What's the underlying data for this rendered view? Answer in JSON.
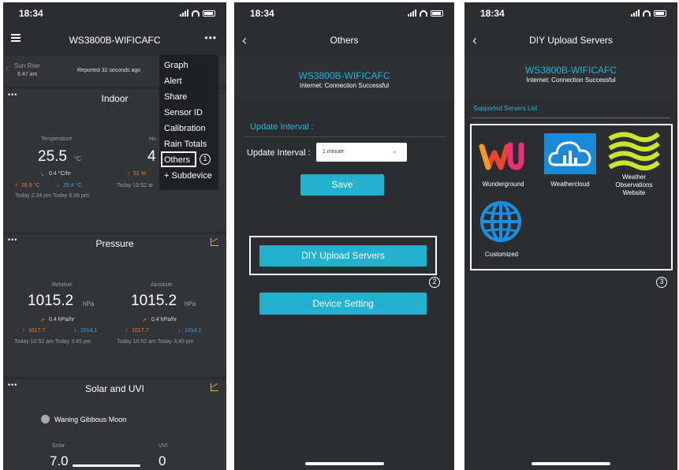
{
  "status_time": "18:34",
  "screen1": {
    "title": "WS3800B-WIFICAFC",
    "sunrise_label": "Sun Rise",
    "sunrise_time": "6:47 am",
    "reported": "Reported 32 seconds ago",
    "indoor": {
      "title": "Indoor",
      "temp_label": "Temperature",
      "temp_value": "25.5",
      "temp_unit": "°C",
      "hum_label": "Hu",
      "hum_value": "4",
      "temp_rate": "0.4 °C/hr",
      "hum_rate": "51 %",
      "temp_max": "26.9 °C",
      "temp_min": "25.4 °C",
      "hum_time": "Today 10:52 ar",
      "temp_times": "Today 2:34 pm   Today 6:28 pm"
    },
    "pressure": {
      "title": "Pressure",
      "rel_label": "Relative",
      "abs_label": "Absolute",
      "rel_value": "1015.2",
      "abs_value": "1015.2",
      "unit": "hPa",
      "rel_rate": "0.4 hPa/hr",
      "abs_rate": "0.4 hPa/hr",
      "rel_max": "1017.7",
      "rel_min": "1014.1",
      "abs_max": "1017.7",
      "abs_min": "1014.1",
      "rel_times": "Today 10:52 am   Today 3:45 pm",
      "abs_times": "Today 10:52 am   Today 3:45 pm"
    },
    "solar": {
      "title": "Solar and UVI",
      "moon": "Waning Gibbous Moon",
      "solar_label": "Solar",
      "uvi_label": "UVI",
      "solar_value": "7.0",
      "uvi_value": "0"
    },
    "menu": [
      "Graph",
      "Alert",
      "Share",
      "Sensor ID",
      "Calibration",
      "Rain Totals",
      "Others",
      "+ Subdevice"
    ],
    "callout": "1"
  },
  "screen2": {
    "title": "Others",
    "device": "WS3800B-WIFICAFC",
    "internet": "Internet: Connection Successful",
    "interval_header": "Update Interval :",
    "interval_label": "Update Interval :",
    "interval_value": "1 minute",
    "save": "Save",
    "diy": "DIY Upload Servers",
    "device_setting": "Device Setting",
    "callout": "2"
  },
  "screen3": {
    "title": "DIY Upload Servers",
    "device": "WS3800B-WIFICAFC",
    "internet": "Internet: Connection Successful",
    "list_label": "Supported Servers List",
    "servers": [
      "Wunderground",
      "Weathercloud",
      "Weather Observations Website",
      "Customized"
    ],
    "callout": "3"
  }
}
